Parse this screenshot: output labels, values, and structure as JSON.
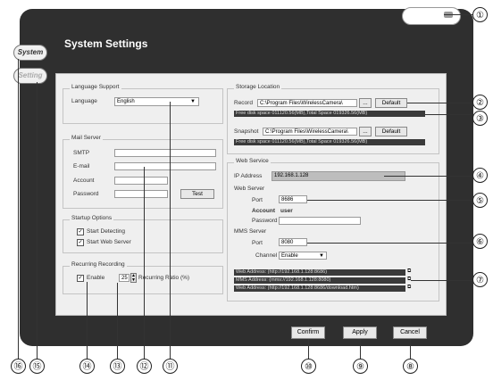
{
  "window": {
    "title": "System Settings"
  },
  "side_tabs": [
    {
      "label": "System"
    },
    {
      "label": "Setting"
    }
  ],
  "language": {
    "group_title": "Language Support",
    "label": "Language",
    "value": "English"
  },
  "mail": {
    "group_title": "Mail Server",
    "smtp_label": "SMTP",
    "email_label": "E-mail",
    "account_label": "Account",
    "password_label": "Password",
    "test_label": "Test"
  },
  "startup": {
    "group_title": "Startup Options",
    "opt1": "Start Detecting",
    "opt2": "Start Web Server"
  },
  "recurring": {
    "group_title": "Recurring Recording",
    "enable_label": "Enable",
    "value": "25",
    "ratio_label": "Recurring Ratio (%)"
  },
  "storage": {
    "group_title": "Storage Location",
    "record_label": "Record",
    "record_path": "C:\\Program Files\\WirelessCamera\\",
    "record_info": "Free disk space 011120.56(MB),Total Space 019326.56(MB)",
    "snapshot_label": "Snapshot",
    "snapshot_path": "C:\\Program Files\\WirelessCamera\\",
    "snapshot_info": "Free disk space 011120.56(MB),Total Space 019326.56(MB)",
    "browse_label": "...",
    "default_label": "Default"
  },
  "web": {
    "group_title": "Web Service",
    "ip_label": "IP Address",
    "ip_value": "192.168.1.128",
    "web_server_label": "Web Server",
    "port_label": "Port",
    "port_value": "8686",
    "account_label": "Account",
    "account_value": "user",
    "password_label": "Password",
    "mms_label": "MMS Server",
    "mms_port_label": "Port",
    "mms_port_value": "8080",
    "channel_label": "Channel",
    "channel_value": "Enable",
    "web_address": "Web Address: (http://192.168.1.128:8686)",
    "mms_address": "MMS Address: (mms://192.168.1.128:8080)",
    "web_address2": "Web Address: (http://192.168.1.128:8686/download.htm)"
  },
  "footer": {
    "confirm": "Confirm",
    "apply": "Apply",
    "cancel": "Cancel"
  },
  "callouts": [
    "①",
    "②",
    "③",
    "④",
    "⑤",
    "⑥",
    "⑦",
    "⑧",
    "⑨",
    "⑩",
    "⑪",
    "⑫",
    "⑬",
    "⑭",
    "⑮",
    "⑯"
  ]
}
